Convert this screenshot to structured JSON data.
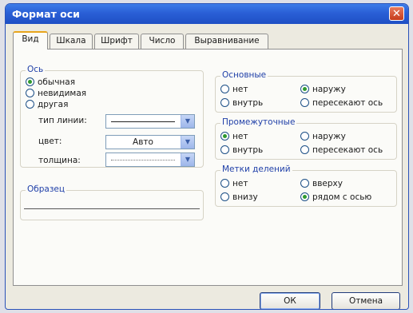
{
  "window": {
    "title": "Формат оси",
    "close_label": "✕"
  },
  "tabs": [
    "Вид",
    "Шкала",
    "Шрифт",
    "Число",
    "Выравнивание"
  ],
  "axis": {
    "legend": "Ось",
    "options": [
      "обычная",
      "невидимая",
      "другая"
    ],
    "selected": "обычная",
    "line_type_label": "тип линии:",
    "color_label": "цвет:",
    "color_value": "Авто",
    "thickness_label": "толщина:"
  },
  "sample": {
    "legend": "Образец"
  },
  "major": {
    "legend": "Основные",
    "options": [
      "нет",
      "наружу",
      "внутрь",
      "пересекают ось"
    ],
    "selected": "наружу"
  },
  "minor": {
    "legend": "Промежуточные",
    "options": [
      "нет",
      "наружу",
      "внутрь",
      "пересекают ось"
    ],
    "selected": "нет"
  },
  "labels": {
    "legend": "Метки делений",
    "options": [
      "нет",
      "вверху",
      "внизу",
      "рядом с осью"
    ],
    "selected": "рядом с осью"
  },
  "buttons": {
    "ok": "ОК",
    "cancel": "Отмена"
  },
  "colors": {
    "title_bar": "#2a5fd6",
    "accent_tab": "#e8a51c",
    "radio_selected": "#2f9a2f"
  }
}
